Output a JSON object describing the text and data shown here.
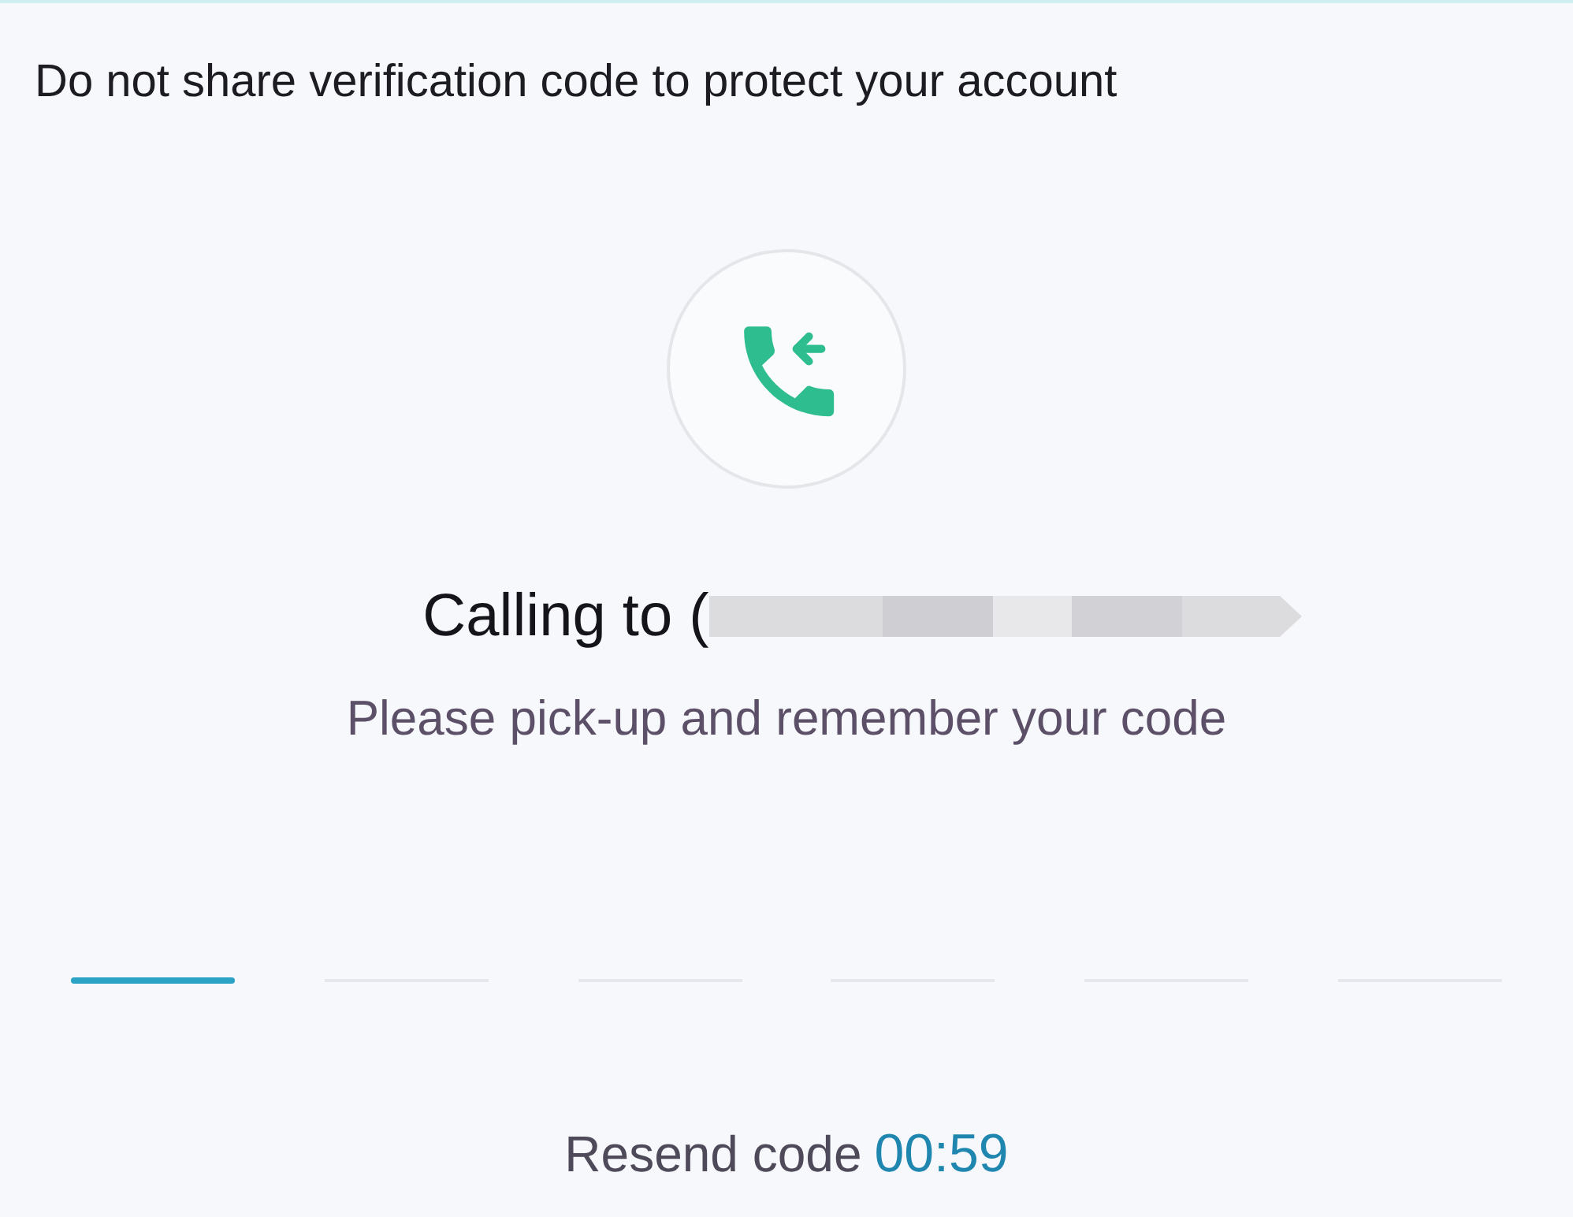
{
  "notice": "Do not share verification code to protect your account",
  "calling": {
    "label": "Calling to (",
    "redacted": true
  },
  "instruction": "Please pick-up and remember your code",
  "code_slots": [
    {
      "selected": true
    },
    {
      "selected": false
    },
    {
      "selected": false
    },
    {
      "selected": false
    },
    {
      "selected": false
    },
    {
      "selected": false
    }
  ],
  "resend": {
    "label": "Resend code",
    "timer": "00:59"
  }
}
